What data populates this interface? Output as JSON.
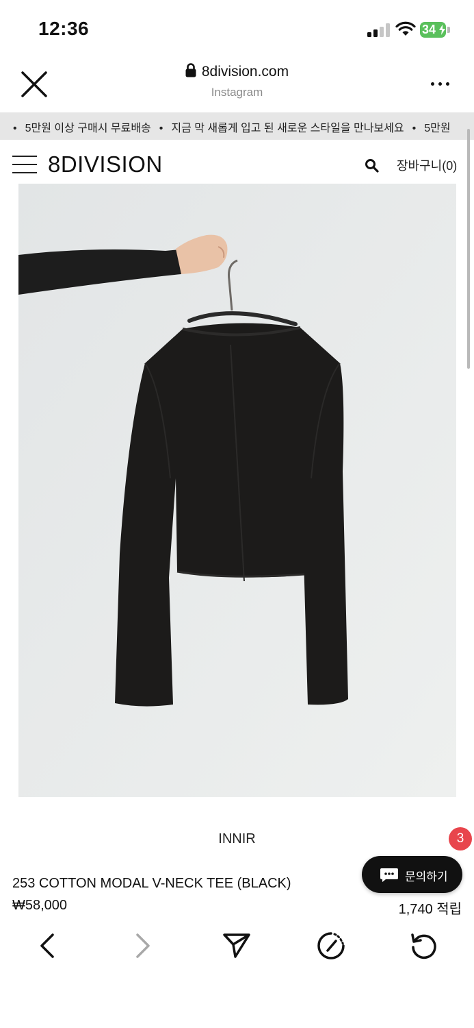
{
  "status_bar": {
    "time": "12:36",
    "battery": "34",
    "icons": [
      "cellular-signal-icon",
      "wifi-icon",
      "battery-charging-icon"
    ]
  },
  "browser": {
    "url": "8division.com",
    "source": "Instagram",
    "icons": [
      "close-icon",
      "lock-icon",
      "more-icon"
    ]
  },
  "announcement": {
    "items": [
      "5만원 이상 구매시 무료배송",
      "지금 막 새롭게 입고 된 새로운 스타일을 만나보세요",
      "5만원"
    ]
  },
  "site_header": {
    "logo": "8DIVISION",
    "cart": "장바구니(0)",
    "icons": [
      "menu-icon",
      "search-icon"
    ]
  },
  "product": {
    "brand": "INNIR",
    "name": "253 COTTON MODAL V-NECK TEE (BLACK)",
    "price": "₩58,000",
    "points": "1,740 적립"
  },
  "chat": {
    "label": "문의하기",
    "badge": "3"
  },
  "bottom_nav": {
    "icons": [
      "back-arrow-icon",
      "forward-arrow-icon",
      "share-icon",
      "speed-dial-icon",
      "reload-icon"
    ]
  },
  "colors": {
    "accent_badge": "#e8454c",
    "battery_green": "#5ac05c",
    "chat_button": "#111111"
  }
}
